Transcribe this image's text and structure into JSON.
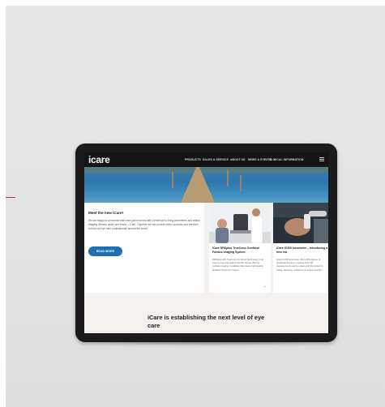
{
  "header": {
    "logo": "icare",
    "nav": [
      "PRODUCTS",
      "SALES & SERVICE",
      "ABOUT US",
      "NEWS & EVENTS",
      "CLINICAL INFORMATION"
    ]
  },
  "intro": {
    "title": "Meet the new iCare!",
    "text": "We are happy to announce that Icare joined forces with Centervue to bring tonometers and retinal imaging devices under one brand – iCare. Together we can provide better products and services to help our eye care professionals around the world.",
    "button": "READ MORE"
  },
  "cards": [
    {
      "title": "iCare DRSplus TrueColor Confocal Fundus Imaging System",
      "text": "DRSplus with TrueColor Confocal Technology is an easy-to-use and patient-friendly device offering multiple imaging modalities that create high-quality, detailed TrueColor images."
    },
    {
      "title": "iCare IC200 tonometer – Introducing a new era",
      "text": "iCare IC200 tonometer offers 200-degree of positional freedom meaning that IOP measurements can be taken with the patient in sitting, standing, reclined or in supine position."
    }
  ],
  "tagline": "iCare is establishing the next level of eye care",
  "colors": {
    "navbar": "#141414",
    "accent_blue": "#1f6fb2",
    "background": "#e5e5e5",
    "tablet_bezel": "#1b1b1d"
  },
  "icons": [
    "hamburger-menu-icon",
    "arrow-right-icon"
  ]
}
